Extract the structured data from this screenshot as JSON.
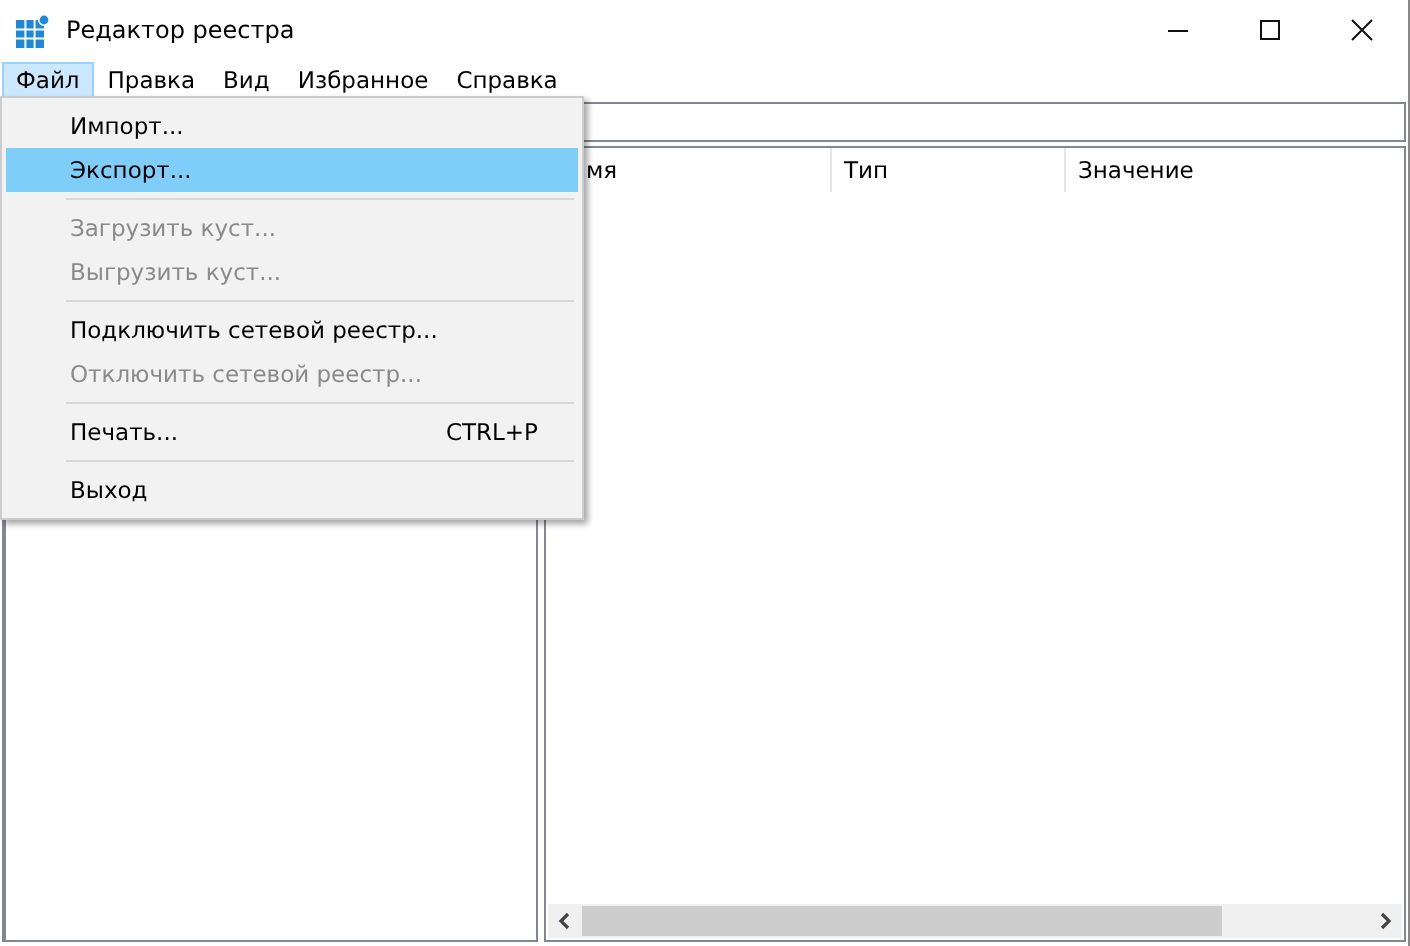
{
  "window": {
    "title": "Редактор реестра"
  },
  "menubar": [
    {
      "label": "Файл",
      "selected": true
    },
    {
      "label": "Правка",
      "selected": false
    },
    {
      "label": "Вид",
      "selected": false
    },
    {
      "label": "Избранное",
      "selected": false
    },
    {
      "label": "Справка",
      "selected": false
    }
  ],
  "file_menu": [
    {
      "kind": "item",
      "label": "Импорт...",
      "disabled": false,
      "selected": false
    },
    {
      "kind": "item",
      "label": "Экспорт...",
      "disabled": false,
      "selected": true
    },
    {
      "kind": "separator"
    },
    {
      "kind": "item",
      "label": "Загрузить куст...",
      "disabled": true,
      "selected": false
    },
    {
      "kind": "item",
      "label": "Выгрузить куст...",
      "disabled": true,
      "selected": false
    },
    {
      "kind": "separator"
    },
    {
      "kind": "item",
      "label": "Подключить сетевой реестр...",
      "disabled": false,
      "selected": false
    },
    {
      "kind": "item",
      "label": "Отключить сетевой реестр...",
      "disabled": true,
      "selected": false
    },
    {
      "kind": "separator"
    },
    {
      "kind": "item",
      "label": "Печать...",
      "shortcut": "CTRL+P",
      "disabled": false,
      "selected": false
    },
    {
      "kind": "separator"
    },
    {
      "kind": "item",
      "label": "Выход",
      "disabled": false,
      "selected": false
    }
  ],
  "values_table": {
    "columns": [
      "мя",
      "Тип",
      "Значение"
    ]
  }
}
